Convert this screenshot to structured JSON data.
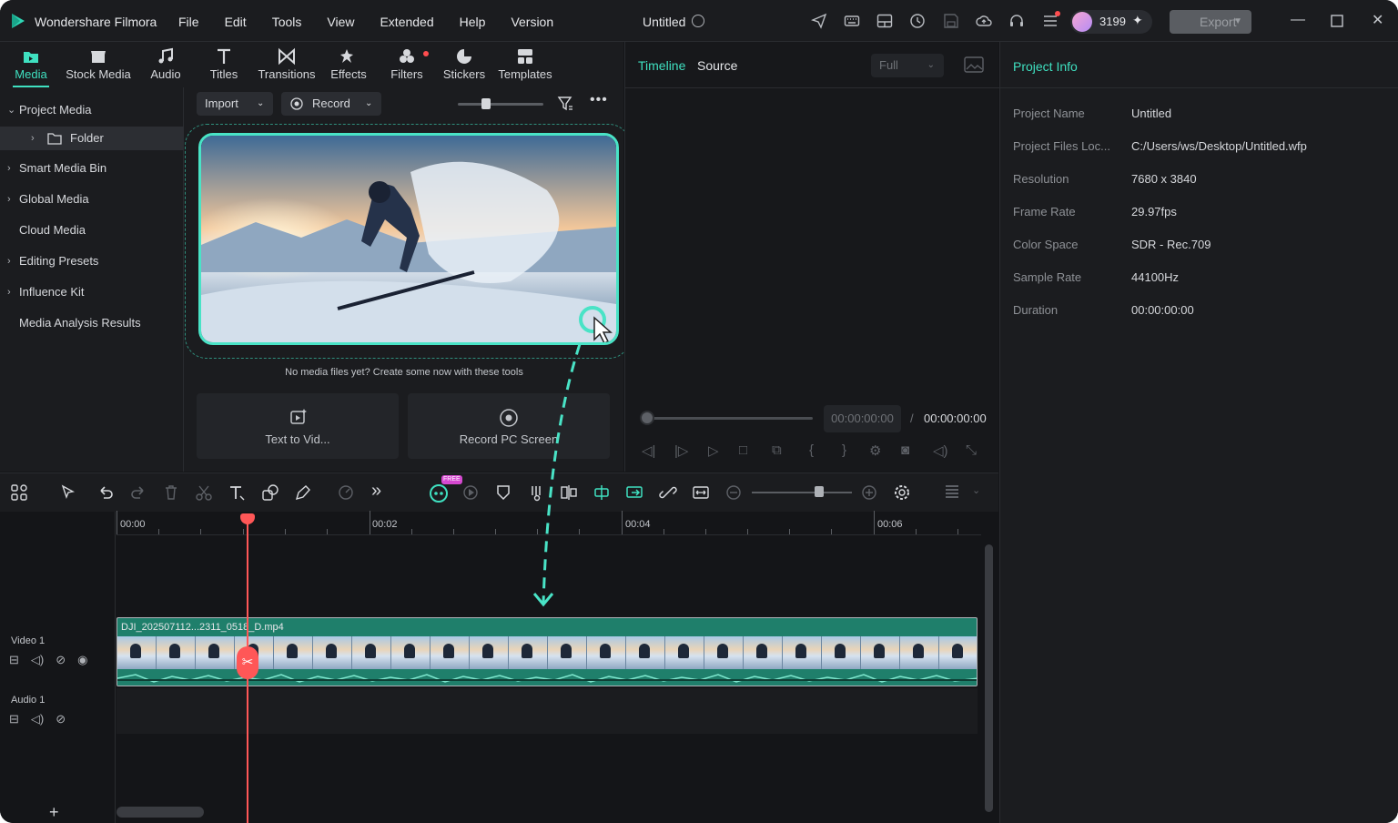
{
  "app": {
    "name": "Wondershare Filmora",
    "doc_title": "Untitled"
  },
  "menu": [
    "File",
    "Edit",
    "Tools",
    "View",
    "Extended",
    "Help",
    "Version"
  ],
  "credits": {
    "count": "3199"
  },
  "export_label": "Export",
  "tabs": [
    {
      "label": "Media",
      "icon": "media-icon"
    },
    {
      "label": "Stock Media",
      "icon": "stock-media-icon"
    },
    {
      "label": "Audio",
      "icon": "music-note-icon"
    },
    {
      "label": "Titles",
      "icon": "text-icon"
    },
    {
      "label": "Transitions",
      "icon": "transitions-icon"
    },
    {
      "label": "Effects",
      "icon": "effects-icon"
    },
    {
      "label": "Filters",
      "icon": "filters-icon"
    },
    {
      "label": "Stickers",
      "icon": "stickers-icon"
    },
    {
      "label": "Templates",
      "icon": "templates-icon"
    }
  ],
  "tree": [
    {
      "label": "Project Media",
      "arrow": "v"
    },
    {
      "label": "Folder",
      "arrow": ">"
    },
    {
      "label": "Smart Media Bin",
      "arrow": ">"
    },
    {
      "label": "Global Media",
      "arrow": ">"
    },
    {
      "label": "Cloud Media",
      "arrow": ""
    },
    {
      "label": "Editing Presets",
      "arrow": ">"
    },
    {
      "label": "Influence Kit",
      "arrow": ">"
    },
    {
      "label": "Media Analysis Results",
      "arrow": ""
    }
  ],
  "media": {
    "import_label": "Import",
    "record_label": "Record",
    "empty_text": "No media files yet? Create some now with these tools",
    "tool1": "Text to Vid...",
    "tool2": "Record PC Screen"
  },
  "viewer": {
    "tab_timeline": "Timeline",
    "tab_source": "Source",
    "quality": "Full",
    "current_time": "00:00:00:00",
    "separator": "/",
    "total_time": "00:00:00:00"
  },
  "project_info": {
    "header": "Project Info",
    "rows": [
      {
        "k": "Project Name",
        "v": "Untitled"
      },
      {
        "k": "Project Files Loc...",
        "v": "C:/Users/ws/Desktop/Untitled.wfp"
      },
      {
        "k": "Resolution",
        "v": "7680 x 3840"
      },
      {
        "k": "Frame Rate",
        "v": "29.97fps"
      },
      {
        "k": "Color Space",
        "v": "SDR - Rec.709"
      },
      {
        "k": "Sample Rate",
        "v": "44100Hz"
      },
      {
        "k": "Duration",
        "v": "00:00:00:00"
      }
    ]
  },
  "timeline": {
    "ruler": [
      "00:00",
      "00:02",
      "00:04",
      "00:06"
    ],
    "tracks": {
      "video": "Video 1",
      "audio": "Audio 1"
    },
    "clip_name": "DJI_202507112...2311_0518_D.mp4",
    "ai_badge": "FREE"
  },
  "colors": {
    "accent": "#3fe0c0",
    "playhead": "#ff5757",
    "clip": "#1f7f6b"
  }
}
